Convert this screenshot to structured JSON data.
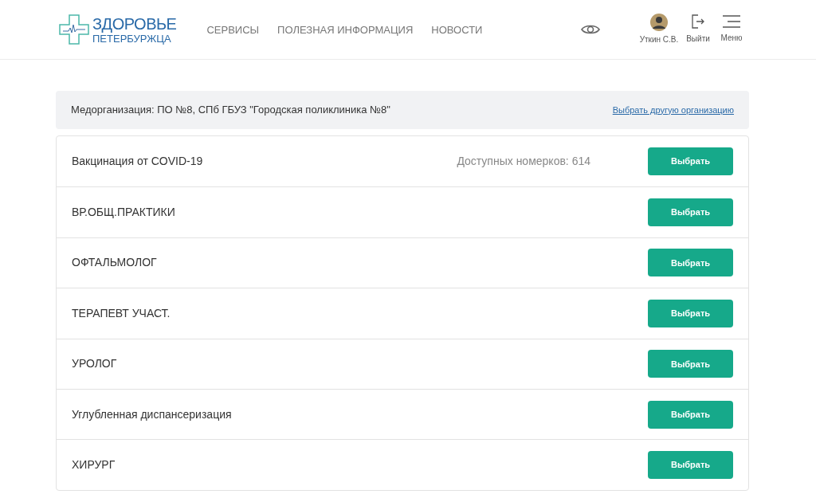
{
  "header": {
    "logo": {
      "line_1": "ЗДОРОВЬЕ",
      "line_2": "ПЕТЕРБУРЖЦА"
    },
    "nav": [
      "СЕРВИСЫ",
      "ПОЛЕЗНАЯ ИНФОРМАЦИЯ",
      "НОВОСТИ"
    ],
    "user": "Уткин С.В.",
    "logout": "Выйти",
    "menu": "Меню"
  },
  "organization": {
    "label": "Медорганизация: ПО №8, СПб ГБУЗ \"Городская поликлиника №8\"",
    "link": "Выбрать другую организацию"
  },
  "services": [
    {
      "name": "Вакцинация от COVID-19",
      "availability": "Доступных номерков: 614",
      "button": "Выбрать"
    },
    {
      "name": "ВР.ОБЩ.ПРАКТИКИ",
      "button": "Выбрать"
    },
    {
      "name": "ОФТАЛЬМОЛОГ",
      "button": "Выбрать"
    },
    {
      "name": "ТЕРАПЕВТ УЧАСТ.",
      "button": "Выбрать"
    },
    {
      "name": "УРОЛОГ",
      "button": "Выбрать"
    },
    {
      "name": "Углубленная диспансеризация",
      "button": "Выбрать"
    },
    {
      "name": "ХИРУРГ",
      "button": "Выбрать"
    }
  ]
}
